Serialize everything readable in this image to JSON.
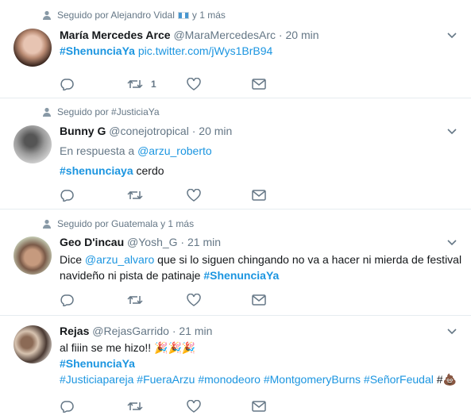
{
  "colors": {
    "accent": "#1b95e0",
    "muted": "#657786",
    "text": "#14171a",
    "divider": "#e6ecf0"
  },
  "tweets": [
    {
      "context_prefix": "Seguido por Alejandro Vidal",
      "context_suffix": "y 1 más",
      "name": "María Mercedes Arce",
      "handle": "@MaraMercedesArc",
      "dot": "·",
      "time": "20 min",
      "hashtag": "#ShenunciaYa",
      "link": "pic.twitter.com/jWys1BrB94",
      "retweet_count": "1"
    },
    {
      "context": "Seguido por #JusticiaYa",
      "name": "Bunny G",
      "handle": "@conejotropical",
      "dot": "·",
      "time": "20 min",
      "reply_prefix": "En respuesta a",
      "reply_to": "@arzu_roberto",
      "hashtag": "#shenunciaya",
      "text": "cerdo"
    },
    {
      "context": "Seguido por Guatemala y 1 más",
      "name": "Geo D'incau",
      "handle": "@Yosh_G",
      "dot": "·",
      "time": "21 min",
      "line1_pre": "Dice",
      "mention": "@arzu_alvaro",
      "line1_post": "que si lo siguen chingando no va a hacer ni mierda de festival",
      "line2_pre": "navideño ni pista de patinaje",
      "hashtag": "#ShenunciaYa"
    },
    {
      "name": "Rejas",
      "handle": "@RejasGarrido",
      "dot": "·",
      "time": "21 min",
      "line1": "al fiiin se me hizo!!",
      "emoji1": "🎉🎉🎉",
      "hashtag_main": "#ShenunciaYa",
      "tags": [
        "#Justiciapareja",
        "#FueraArzu",
        "#monodeoro",
        "#MontgomeryBurns",
        "#SeñorFeudal"
      ],
      "tail": "#",
      "emoji2": "💩"
    }
  ],
  "icons": {
    "reply": "reply-icon",
    "retweet": "retweet-icon",
    "like": "heart-icon",
    "dm": "envelope-icon",
    "caret": "chevron-down-icon",
    "context": "person-icon"
  }
}
